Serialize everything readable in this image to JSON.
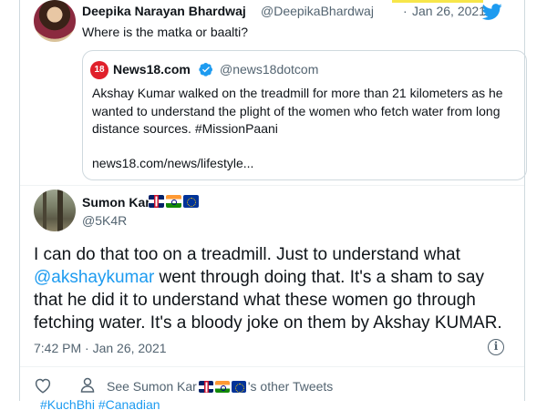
{
  "parent_tweet": {
    "author_name": "Deepika Narayan Bhardwaj",
    "handle": "@DeepikaBhardwaj",
    "separator": "·",
    "date": "Jan 26, 2021",
    "text": "Where is the matka or baalti?"
  },
  "quoted_tweet": {
    "logo_text": "18",
    "author_name": "News18.com",
    "handle": "@news18dotcom",
    "text": "Akshay Kumar walked on the treadmill for more than 21 kilometers as he wanted to understand the plight of the women who fetch water from long distance sources. #MissionPaani",
    "link": "news18.com/news/lifestyle..."
  },
  "main_tweet": {
    "author_name": "Sumon Kar",
    "handle": "@5K4R",
    "text_before": "I can do that too on a treadmill. Just to understand what ",
    "mention": "@akshaykumar",
    "text_after": " went through doing that. It's a sham to say that he did it to understand what these women go through fetching water. It's a bloody joke on them by Akshay KUMAR.",
    "timestamp": "7:42 PM · Jan 26, 2021",
    "info_glyph": "i",
    "see_more_prefix": "See Sumon Kar",
    "see_more_suffix": "'s other Tweets"
  },
  "footer_text": "#KuchBhi #Canadian",
  "colors": {
    "link_blue": "#1d9bf0",
    "secondary_text": "#536471",
    "twitter_blue": "#1d9bf0",
    "news18_red": "#e0202b"
  },
  "icons": [
    "twitter-bird-icon",
    "verified-badge-icon",
    "info-icon",
    "heart-icon",
    "person-icon",
    "uk-flag-icon",
    "india-flag-icon",
    "eu-flag-icon"
  ]
}
